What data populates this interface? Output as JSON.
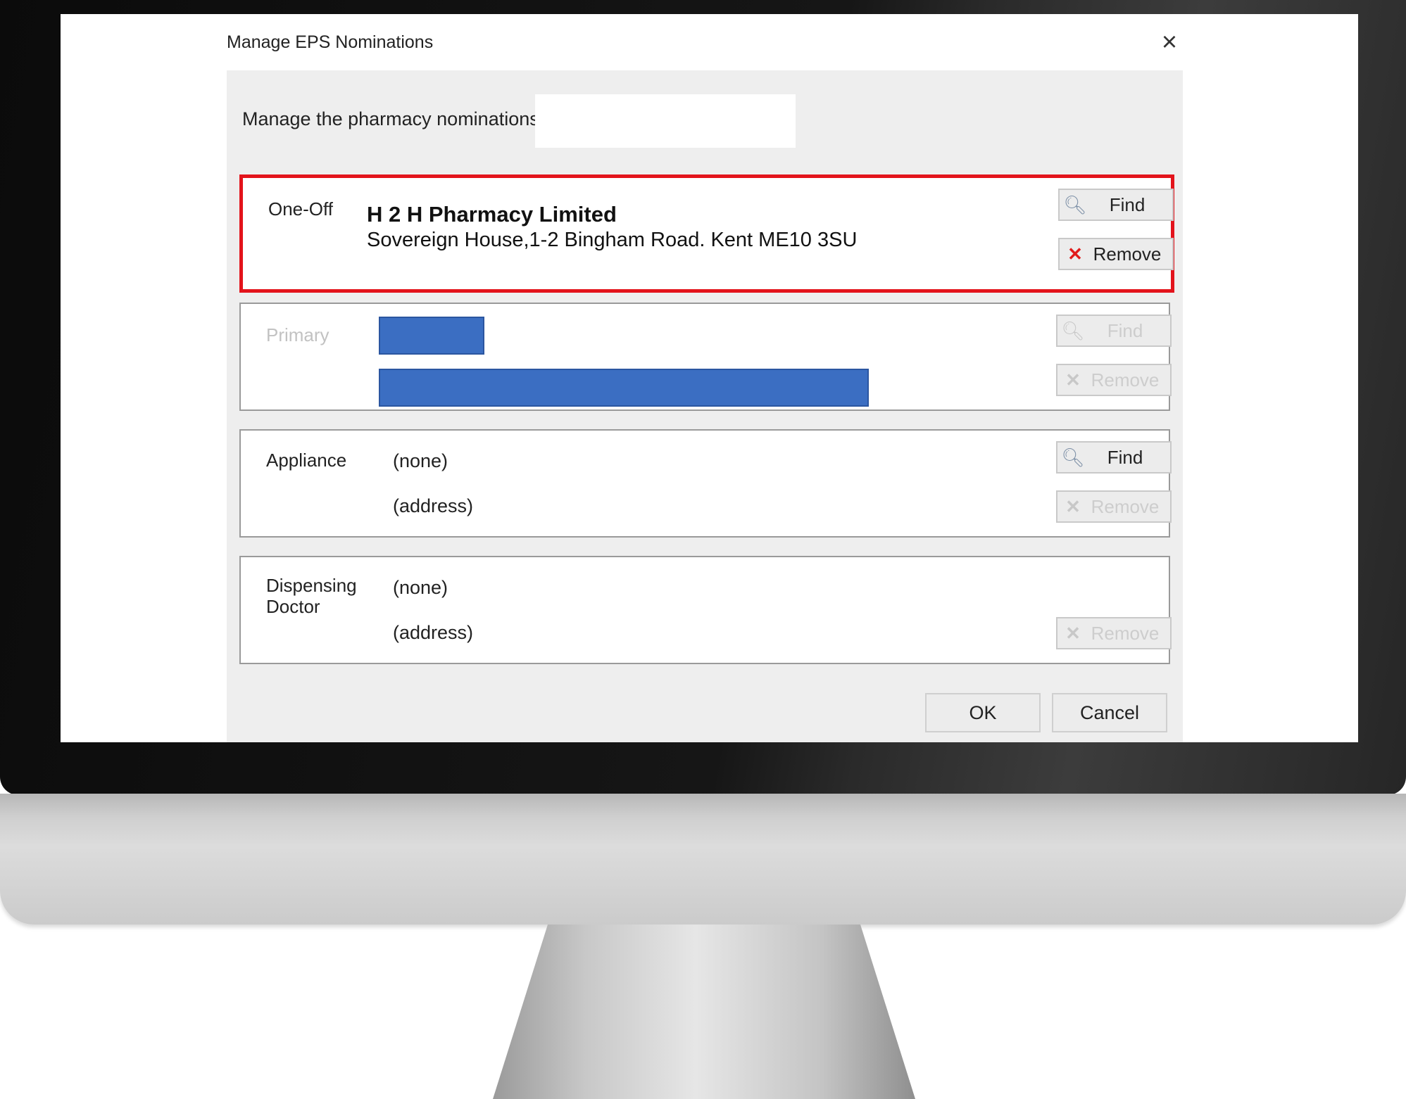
{
  "dialog": {
    "title": "Manage EPS Nominations",
    "prompt": "Manage the pharmacy nominations for"
  },
  "one_off": {
    "label": "One-Off",
    "pharmacy_name": "H 2 H Pharmacy Limited",
    "pharmacy_address": "Sovereign House,1-2 Bingham Road. Kent ME10 3SU",
    "find_label": "Find",
    "remove_label": "Remove"
  },
  "primary": {
    "label": "Primary",
    "find_label": "Find",
    "remove_label": "Remove"
  },
  "appliance": {
    "label": "Appliance",
    "name": "(none)",
    "address": "(address)",
    "find_label": "Find",
    "remove_label": "Remove"
  },
  "dispensing_doctor": {
    "label": "Dispensing Doctor",
    "name": "(none)",
    "address": "(address)",
    "remove_label": "Remove"
  },
  "footer": {
    "ok_label": "OK",
    "cancel_label": "Cancel"
  },
  "icons": {
    "find": "magnifier-icon",
    "remove": "red-x-icon",
    "close": "close-x-icon"
  },
  "colors": {
    "highlight": "#e3131b",
    "redaction": "#3b6ec2"
  }
}
